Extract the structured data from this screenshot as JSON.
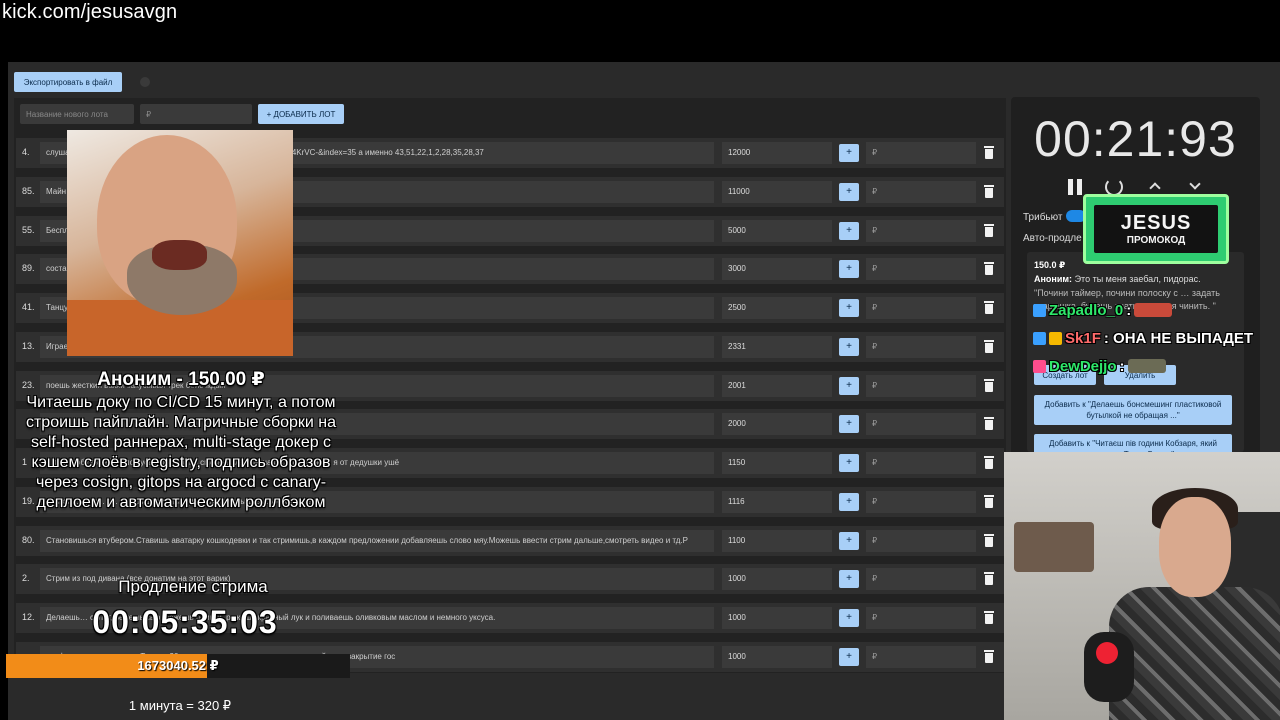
{
  "page": {
    "url": "kick.com/jesusavgn"
  },
  "toolbar": {
    "export_label": "Экспортировать в файл"
  },
  "new_lot": {
    "name_placeholder": "Название нового лота",
    "price_placeholder": "₽",
    "add_label": "+ ДОБАВИТЬ ЛОТ"
  },
  "lots": [
    {
      "num": "4.",
      "name": "слушае…=kcw4VPDG9Lw&list=PL2oDceHo5WQ0YtkDvyplKKRTisN4KrVC-&index=35 а именно 43,51,22,1,2,28,35,28,37",
      "amount": "12000"
    },
    {
      "num": "85.",
      "name": "Майн",
      "amount": "11000"
    },
    {
      "num": "55.",
      "name": "Беспл",
      "amount": "5000"
    },
    {
      "num": "89.",
      "name": "соста…шь вилки",
      "amount": "3000"
    },
    {
      "num": "41.",
      "name": "Танцу…какашки крылышки / какашки мне в кармашки",
      "amount": "2500"
    },
    {
      "num": "13.",
      "name": "Играе",
      "amount": "2331"
    },
    {
      "num": "23.",
      "name": "поешь жесткий вакхи закусывая трек бейс ждый",
      "amount": "2001"
    },
    {
      "num": "",
      "name": "",
      "amount": "2000"
    },
    {
      "num": "1",
      "name": "я по коробу скребен, по сусеку метен, на сметане мешон, на окошке стужен, я от дедушки ушё",
      "amount": "1150"
    },
    {
      "num": "19.",
      "name": "Ахыхы… артой. по. пылдышкам. Лыгыдышкам крылышкам. ихихяхя чеч",
      "amount": "1116"
    },
    {
      "num": "80.",
      "name": "Становишься втубером.Ставишь аватарку кошкодевки и так стримишь,в каждом предложении добавляешь слово мяу.Можешь ввести стрим дальше,смотреть видео и тд.Р",
      "amount": "1100"
    },
    {
      "num": "2.",
      "name": "Стрим из под дивана (все донатим на этот варик)",
      "amount": "1000"
    },
    {
      "num": "12.",
      "name": "Делаешь… салат, режешь сыр, режешь оливки, режешь красный лук и поливаешь оливковым маслом и немного уксуса.",
      "amount": "1000"
    },
    {
      "num": "",
      "name": "…официальных данных. Так что 30 минут стоишь на коленях говоря подайте на закрытие гос",
      "amount": "1000"
    }
  ],
  "lot_add_placeholder": "₽",
  "lot_plus_label": "+",
  "timer": {
    "value": "00:21:93",
    "tribute_label": "Трибьют",
    "auto_label": "Авто-продле"
  },
  "promo": {
    "title": "JESUS",
    "subtitle": "ПРОМОКОД"
  },
  "donation_card": {
    "amount": "150.0 ₽",
    "author": "Аноним:",
    "message": "Это ты меня заебал, пидорас.",
    "sub": "\"Почини таймер, почини полоску с … задать тварюшка, будешь знать как меня чинить. \"",
    "create_lot": "Создать лот",
    "delete": "Удалить",
    "add_to_1": "Добавить к \"Делаешь бонсмешинг пластиковой бутылкой не обращая ...\"",
    "add_to_2": "Добавить к \"Читаєш пів години Кобзаря, який називає Тарас Грис...\""
  },
  "chat": [
    {
      "name": "Zapadlo_0",
      "text": ":",
      "name_color": "#2ee86a",
      "badge_color": "#3aa0ff",
      "emote_color": "#c94a3a"
    },
    {
      "name": "Sk1F",
      "text": ": ОНА НЕ ВЫПАДЕТ",
      "name_color": "#ff6b6b",
      "badge_color": "#3aa0ff",
      "badge2_color": "#f5b800"
    },
    {
      "name": "DewDejjo",
      "text": ":",
      "name_color": "#2ee86a",
      "badge_color": "#ff4d8d",
      "emote_color": "#6b6b55"
    }
  ],
  "overlay": {
    "donor_title": "Аноним - 150.00 ₽",
    "donor_msg": "Читаешь доку по CI/CD 15 минут, а потом строишь пайплайн. Матричные сборки на self-hosted раннерах, multi-stage докер с кэшем слоёв в registry, подпись образов через cosign, gitops на argocd с canary-деплоем и автоматическим роллбэком",
    "extension_label": "Продление стрима",
    "extension_timer": "00:05:35:03",
    "progress_text": "1673040.52 ₽",
    "progress_fraction": 0.585,
    "rate": "1 минута = 320 ₽"
  }
}
